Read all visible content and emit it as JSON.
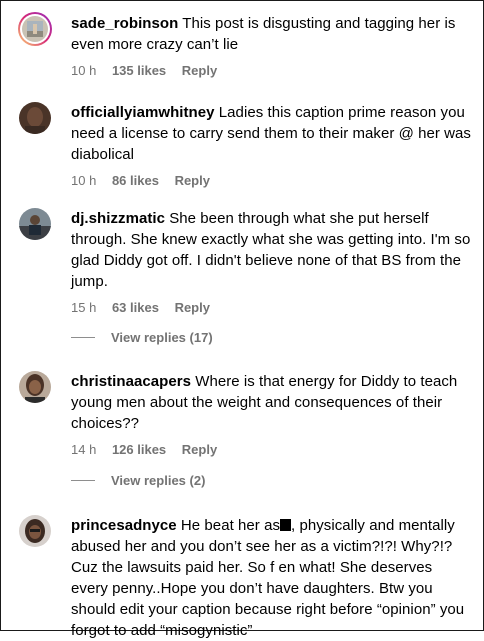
{
  "comments": [
    {
      "username": "sade_robinson",
      "text": "This post is disgusting and tagging her is even more crazy can’t lie",
      "time": "10 h",
      "likes": "135 likes",
      "reply": "Reply",
      "avatar_icon": "avatar-icon-story-ring"
    },
    {
      "username": "officiallyiamwhitney",
      "text": "Ladies this caption prime reason you need a license to carry send them to their maker @ her was diabolical",
      "time": "10 h",
      "likes": "86 likes",
      "reply": "Reply",
      "avatar_icon": "avatar-icon"
    },
    {
      "username": "dj.shizzmatic",
      "text": "She been through what she put herself through. She knew exactly what she was getting into. I'm so glad Diddy got off. I didn't believe none of that BS from the jump.",
      "time": "15 h",
      "likes": "63 likes",
      "reply": "Reply",
      "avatar_icon": "avatar-icon",
      "view_replies": "View replies (17)"
    },
    {
      "username": "christinaacapers",
      "text": "Where is that energy for Diddy to teach young men about the weight and consequences of their choices??",
      "time": "14 h",
      "likes": "126 likes",
      "reply": "Reply",
      "avatar_icon": "avatar-icon",
      "view_replies": "View replies (2)"
    },
    {
      "username": "princesadnyce",
      "text_part1": "He beat her as",
      "text_part2": ", physically and mentally abused her and you don’t see her as a victim?!?! Why?!? Cuz the lawsuits paid her. So f en what! She deserves every penny..Hope you don’t have daughters. Btw you should edit your caption because right before “opinion” you forgot to add “misogynistic”",
      "avatar_icon": "avatar-icon"
    }
  ],
  "colors": {
    "meta_gray": "#737373",
    "story_ring_start": "#d6249f",
    "story_ring_end": "#fd5949"
  }
}
